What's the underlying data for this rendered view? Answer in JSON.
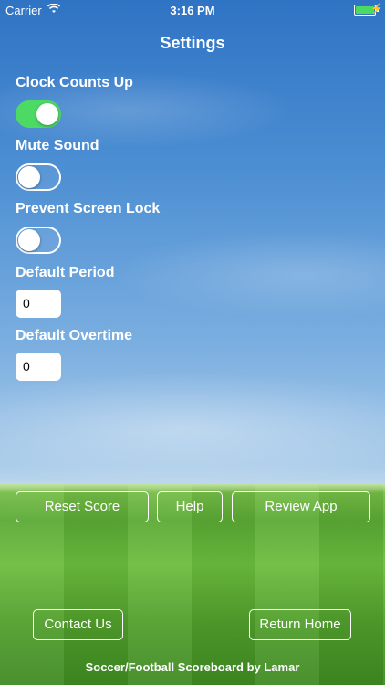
{
  "status_bar": {
    "carrier": "Carrier",
    "wifi_icon": "wifi-icon",
    "time": "3:16 PM",
    "battery_icon": "battery-icon",
    "charging_icon": "bolt-icon"
  },
  "header": {
    "title": "Settings"
  },
  "settings": {
    "clock_counts_up": {
      "label": "Clock Counts Up",
      "state": "on"
    },
    "mute_sound": {
      "label": "Mute Sound",
      "state": "off"
    },
    "prevent_screen_lock": {
      "label": "Prevent Screen Lock",
      "state": "off"
    },
    "default_period": {
      "label": "Default Period",
      "value": "0"
    },
    "default_overtime": {
      "label": "Default Overtime",
      "value": "0"
    }
  },
  "buttons": {
    "reset_score": "Reset Score",
    "help": "Help",
    "review_app": "Review App",
    "contact_us": "Contact Us",
    "return_home": "Return Home"
  },
  "footer": {
    "text": "Soccer/Football Scoreboard by Lamar"
  },
  "colors": {
    "toggle_on": "#4cd964",
    "sky": "#4d8fd3",
    "grass": "#5aa934"
  }
}
